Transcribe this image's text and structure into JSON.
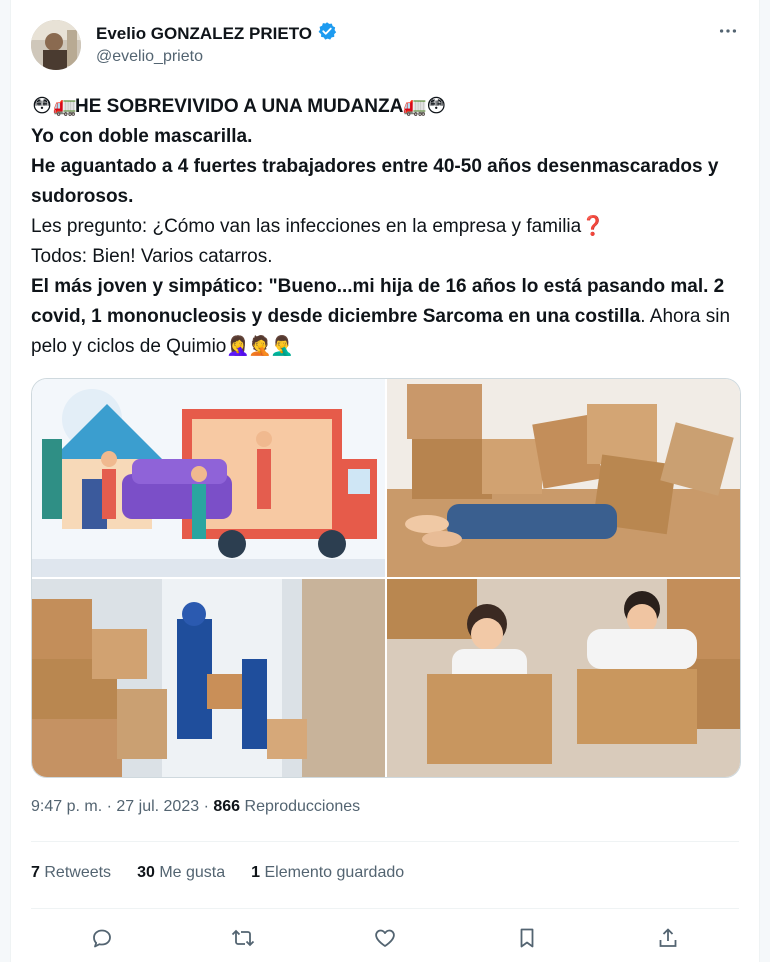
{
  "author": {
    "name": "Evelio GONZALEZ PRIETO",
    "handle": "@evelio_prieto",
    "verified_color": "#1d9bf0"
  },
  "tweet": {
    "line1": "HE SOBREVIVIDO A UNA MUDANZA",
    "line2": "Yo con doble mascarilla.",
    "line3": "He aguantado a 4 fuertes trabajadores entre 40-50 años desenmascarados y sudorosos.",
    "line4": "Les pregunto: ¿Cómo van las infecciones en la empresa y familia",
    "line5": "Todos: Bien! Varios catarros.",
    "line6_bold": "El más joven y simpático: \"Bueno...mi hija de 16 años lo está pasando mal. 2 covid, 1 mononucleosis y desde diciembre Sarcoma en una costilla",
    "line6_rest": ". Ahora sin pelo y ciclos de Quimio"
  },
  "emojis": {
    "flushed": "😳",
    "truck": "🚛",
    "question": "❓",
    "facepalm": "🤦‍♀️",
    "facepalm2": "🤦",
    "facepalm3": "🤦‍♂️"
  },
  "meta": {
    "time": "9:47 p. m.",
    "dot": "·",
    "date": "27 jul. 2023",
    "views_count": "866",
    "views_label": "Reproducciones"
  },
  "stats": {
    "retweets_count": "7",
    "retweets_label": "Retweets",
    "likes_count": "30",
    "likes_label": "Me gusta",
    "bookmarks_count": "1",
    "bookmarks_label": "Elemento guardado"
  },
  "icons": {
    "more": "more-icon",
    "reply": "reply-icon",
    "retweet": "retweet-icon",
    "like": "like-icon",
    "bookmark": "bookmark-icon",
    "share": "share-icon"
  },
  "colors": {
    "text": "#0f1419",
    "muted": "#536471",
    "accent": "#1d9bf0"
  }
}
